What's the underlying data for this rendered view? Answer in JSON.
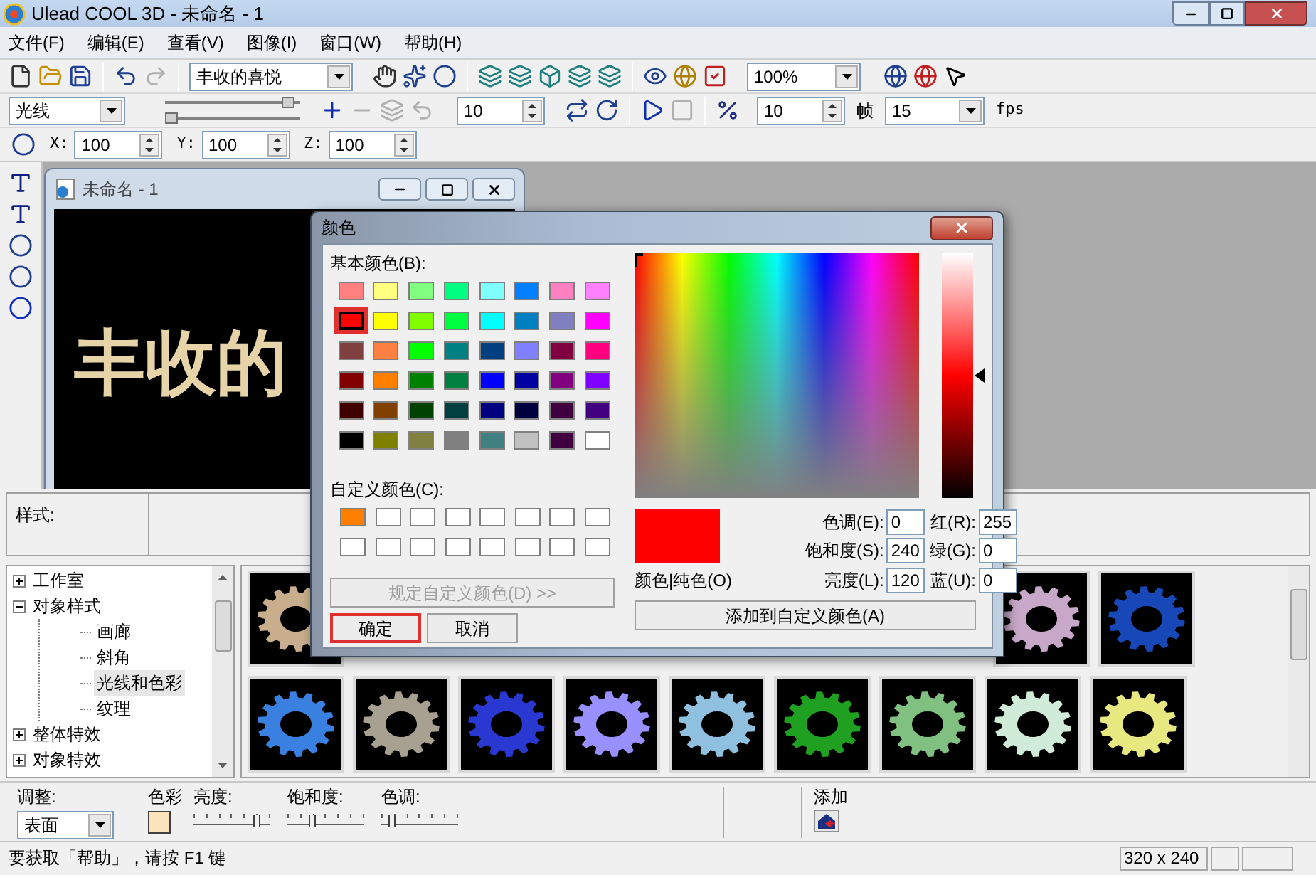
{
  "window": {
    "title": "Ulead COOL 3D - 未命名 - 1"
  },
  "menu": [
    "文件(F)",
    "编辑(E)",
    "查看(V)",
    "图像(I)",
    "窗口(W)",
    "帮助(H)"
  ],
  "toolbar_1": {
    "text_combo": "丰收的喜悦",
    "zoom_combo": "100%"
  },
  "toolbar_2": {
    "type_combo": "光线",
    "sliders": [
      {
        "level": 0.95
      },
      {
        "level": 0
      }
    ],
    "spin_1": "10",
    "spin_2": "10",
    "frame_label": "帧",
    "fps_combo": "15",
    "fps_label": "fps"
  },
  "position": [
    {
      "label": "X:",
      "value": "100"
    },
    {
      "label": "Y:",
      "value": "100"
    },
    {
      "label": "Z:",
      "value": "100"
    }
  ],
  "document": {
    "title": "未命名 - 1",
    "canvas_text": "丰收的"
  },
  "style_panel": {
    "label": "样式:"
  },
  "tree": [
    {
      "label": "工作室",
      "expanded": false,
      "selected": false
    },
    {
      "label": "对象样式",
      "expanded": true,
      "selected": false,
      "children": [
        {
          "label": "画廊",
          "selected": false
        },
        {
          "label": "斜角",
          "selected": false
        },
        {
          "label": "光线和色彩",
          "selected": true
        },
        {
          "label": "纹理",
          "selected": false
        }
      ]
    },
    {
      "label": "整体特效",
      "expanded": false,
      "selected": false
    },
    {
      "label": "对象特效",
      "expanded": false,
      "selected": false
    }
  ],
  "thumbnails_row_1": [
    {
      "color": "#c8ae8c"
    },
    {
      "color": "#c8a8c8"
    },
    {
      "color": "#1848b8"
    }
  ],
  "thumbnails_row_2": [
    {
      "color": "#3a80e0"
    },
    {
      "color": "#a8a090"
    },
    {
      "color": "#2838d0"
    },
    {
      "color": "#9890ff"
    },
    {
      "color": "#90c0e0"
    },
    {
      "color": "#20a020"
    },
    {
      "color": "#80c080"
    },
    {
      "color": "#d0ecd8"
    },
    {
      "color": "#e8e880"
    }
  ],
  "adjust": {
    "label": "调整:",
    "combo": "表面",
    "color_label": "色彩",
    "sliders": [
      {
        "label": "亮度:",
        "level": 0.85
      },
      {
        "label": "饱和度:",
        "level": 0.3
      },
      {
        "label": "色调:",
        "level": 0.1
      }
    ],
    "add_label": "添加"
  },
  "status_bar": {
    "text": "要获取「帮助」，请按 F1 键",
    "size": "320 x 240"
  },
  "color_dialog": {
    "title": "颜色",
    "basic_label": "基本颜色(B):",
    "basic_colors": [
      {
        "color": "#ff8080",
        "selected": false,
        "highlighted": false
      },
      {
        "color": "#ffff80",
        "selected": false,
        "highlighted": false
      },
      {
        "color": "#80ff80",
        "selected": false,
        "highlighted": false
      },
      {
        "color": "#00ff80",
        "selected": false,
        "highlighted": false
      },
      {
        "color": "#80ffff",
        "selected": false,
        "highlighted": false
      },
      {
        "color": "#0080ff",
        "selected": false,
        "highlighted": false
      },
      {
        "color": "#ff80c0",
        "selected": false,
        "highlighted": false
      },
      {
        "color": "#ff80ff",
        "selected": false,
        "highlighted": false
      },
      {
        "color": "#ff0000",
        "selected": true,
        "highlighted": true
      },
      {
        "color": "#ffff00",
        "selected": false,
        "highlighted": false
      },
      {
        "color": "#80ff00",
        "selected": false,
        "highlighted": false
      },
      {
        "color": "#00ff40",
        "selected": false,
        "highlighted": false
      },
      {
        "color": "#00ffff",
        "selected": false,
        "highlighted": false
      },
      {
        "color": "#0080c0",
        "selected": false,
        "highlighted": false
      },
      {
        "color": "#8080c0",
        "selected": false,
        "highlighted": false
      },
      {
        "color": "#ff00ff",
        "selected": false,
        "highlighted": false
      },
      {
        "color": "#804040",
        "selected": false,
        "highlighted": false
      },
      {
        "color": "#ff8040",
        "selected": false,
        "highlighted": false
      },
      {
        "color": "#00ff00",
        "selected": false,
        "highlighted": false
      },
      {
        "color": "#008080",
        "selected": false,
        "highlighted": false
      },
      {
        "color": "#004080",
        "selected": false,
        "highlighted": false
      },
      {
        "color": "#8080ff",
        "selected": false,
        "highlighted": false
      },
      {
        "color": "#800040",
        "selected": false,
        "highlighted": false
      },
      {
        "color": "#ff0080",
        "selected": false,
        "highlighted": false
      },
      {
        "color": "#800000",
        "selected": false,
        "highlighted": false
      },
      {
        "color": "#ff8000",
        "selected": false,
        "highlighted": false
      },
      {
        "color": "#008000",
        "selected": false,
        "highlighted": false
      },
      {
        "color": "#008040",
        "selected": false,
        "highlighted": false
      },
      {
        "color": "#0000ff",
        "selected": false,
        "highlighted": false
      },
      {
        "color": "#0000a0",
        "selected": false,
        "highlighted": false
      },
      {
        "color": "#800080",
        "selected": false,
        "highlighted": false
      },
      {
        "color": "#8000ff",
        "selected": false,
        "highlighted": false
      },
      {
        "color": "#400000",
        "selected": false,
        "highlighted": false
      },
      {
        "color": "#804000",
        "selected": false,
        "highlighted": false
      },
      {
        "color": "#004000",
        "selected": false,
        "highlighted": false
      },
      {
        "color": "#004040",
        "selected": false,
        "highlighted": false
      },
      {
        "color": "#000080",
        "selected": false,
        "highlighted": false
      },
      {
        "color": "#000040",
        "selected": false,
        "highlighted": false
      },
      {
        "color": "#400040",
        "selected": false,
        "highlighted": false
      },
      {
        "color": "#400080",
        "selected": false,
        "highlighted": false
      },
      {
        "color": "#000000",
        "selected": false,
        "highlighted": false
      },
      {
        "color": "#808000",
        "selected": false,
        "highlighted": false
      },
      {
        "color": "#808040",
        "selected": false,
        "highlighted": false
      },
      {
        "color": "#808080",
        "selected": false,
        "highlighted": false
      },
      {
        "color": "#408080",
        "selected": false,
        "highlighted": false
      },
      {
        "color": "#c0c0c0",
        "selected": false,
        "highlighted": false
      },
      {
        "color": "#400040",
        "selected": false,
        "highlighted": false
      },
      {
        "color": "#ffffff",
        "selected": false,
        "highlighted": false
      }
    ],
    "custom_label": "自定义颜色(C):",
    "custom_colors": [
      {
        "color": "#ff8000"
      },
      {
        "color": "#ffffff"
      },
      {
        "color": "#ffffff"
      },
      {
        "color": "#ffffff"
      },
      {
        "color": "#ffffff"
      },
      {
        "color": "#ffffff"
      },
      {
        "color": "#ffffff"
      },
      {
        "color": "#ffffff"
      },
      {
        "color": "#ffffff"
      },
      {
        "color": "#ffffff"
      },
      {
        "color": "#ffffff"
      },
      {
        "color": "#ffffff"
      },
      {
        "color": "#ffffff"
      },
      {
        "color": "#ffffff"
      },
      {
        "color": "#ffffff"
      },
      {
        "color": "#ffffff"
      }
    ],
    "define_button": {
      "label": "规定自定义颜色(D) >>",
      "disabled": true
    },
    "ok_button": {
      "label": "确定",
      "highlighted": true
    },
    "cancel_button": {
      "label": "取消",
      "highlighted": false
    },
    "luminance": {
      "level": 0.5
    },
    "preview_label": "颜色|纯色(O)",
    "fields": [
      {
        "label": "色调(E):",
        "value": "0"
      },
      {
        "label": "红(R):",
        "value": "255"
      },
      {
        "label": "饱和度(S):",
        "value": "240"
      },
      {
        "label": "绿(G):",
        "value": "0"
      },
      {
        "label": "亮度(L):",
        "value": "120"
      },
      {
        "label": "蓝(U):",
        "value": "0"
      }
    ],
    "add_button": "添加到自定义颜色(A)"
  }
}
